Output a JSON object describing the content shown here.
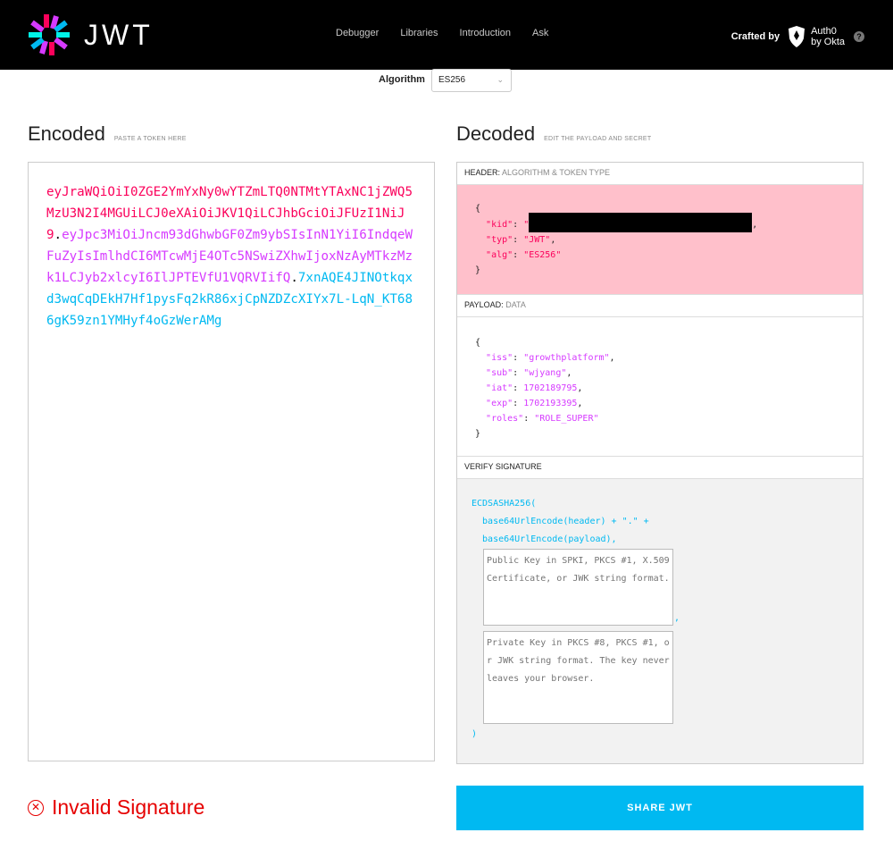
{
  "app": {
    "logo_text": "JWT"
  },
  "nav": {
    "items": [
      "Debugger",
      "Libraries",
      "Introduction",
      "Ask"
    ]
  },
  "crafted": {
    "label": "Crafted by",
    "brand_line1": "Auth0",
    "brand_line2": "by Okta",
    "help": "?"
  },
  "algorithm": {
    "label": "Algorithm",
    "selected": "ES256"
  },
  "encoded": {
    "title": "Encoded",
    "subtitle": "PASTE A TOKEN HERE",
    "token_header": "eyJraWQiOiI0ZGE2YmYxNy0wYTZmLTQ0NTMtYTAxNC1jZWQ5MzU3N2I4MGUiLCJ0eXAiOiJKV1QiLCJhbGciOiJFUzI1NiJ9",
    "token_payload": "eyJpc3MiOiJncm93dGhwbGF0Zm9ybSIsInN1YiI6IndqeWFuZyIsImlhdCI6MTcwMjE4OTc5NSwiZXhwIjoxNzAyMTkzMzk1LCJyb2xlcyI6IlJPTEVfU1VQRVIifQ",
    "token_signature": "7xnAQE4JINOtkqxd3wqCqDEkH7Hf1pysFq2kR86xjCpNZDZcXIYx7L-LqN_KT686gK59zn1YMHyf4oGzWerAMg",
    "dot": "."
  },
  "decoded": {
    "title": "Decoded",
    "subtitle": "EDIT THE PAYLOAD AND SECRET",
    "header_section": {
      "label": "HEADER:",
      "muted": "ALGORITHM & TOKEN TYPE"
    },
    "payload_section": {
      "label": "PAYLOAD:",
      "muted": "DATA"
    },
    "verify_section": {
      "label": "VERIFY SIGNATURE"
    },
    "header_json": {
      "kid_key": "\"kid\"",
      "typ_key": "\"typ\"",
      "typ_val": "\"JWT\"",
      "alg_key": "\"alg\"",
      "alg_val": "\"ES256\""
    },
    "payload_json": {
      "iss_key": "\"iss\"",
      "iss_val": "\"growthplatform\"",
      "sub_key": "\"sub\"",
      "sub_val": "\"wjyang\"",
      "iat_key": "\"iat\"",
      "iat_val": "1702189795",
      "exp_key": "\"exp\"",
      "exp_val": "1702193395",
      "roles_key": "\"roles\"",
      "roles_val": "\"ROLE_SUPER\""
    },
    "verify": {
      "fn": "ECDSASHA256(",
      "line1": "  base64UrlEncode(header) + \".\" +",
      "line2": "  base64UrlEncode(payload),",
      "public_key_placeholder": "Public Key in SPKI, PKCS #1, X.509 Certificate, or JWK string format.",
      "private_key_placeholder": "Private Key in PKCS #8, PKCS #1, or JWK string format. The key never leaves your browser.",
      "comma": ",",
      "close": ")"
    }
  },
  "status": {
    "invalid_text": "Invalid Signature",
    "icon": "x-circle-icon"
  },
  "share": {
    "label": "SHARE JWT"
  },
  "colors": {
    "header": "#fb015b",
    "payload": "#d63aff",
    "signature": "#00b9f1",
    "header_bg": "#ffc0cb",
    "invalid": "#e60000"
  }
}
